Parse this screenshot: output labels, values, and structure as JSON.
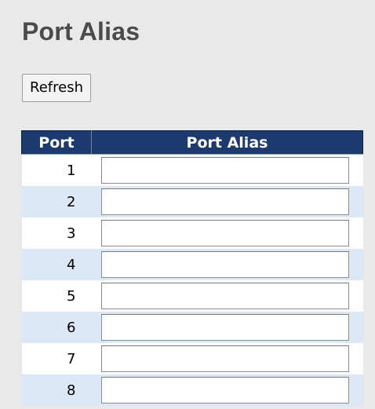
{
  "page": {
    "title": "Port Alias",
    "refresh_label": "Refresh"
  },
  "table": {
    "headers": {
      "port": "Port",
      "alias": "Port Alias"
    },
    "rows": [
      {
        "port": "1",
        "alias": ""
      },
      {
        "port": "2",
        "alias": ""
      },
      {
        "port": "3",
        "alias": ""
      },
      {
        "port": "4",
        "alias": ""
      },
      {
        "port": "5",
        "alias": ""
      },
      {
        "port": "6",
        "alias": ""
      },
      {
        "port": "7",
        "alias": ""
      },
      {
        "port": "8",
        "alias": ""
      }
    ]
  },
  "colors": {
    "header_bg": "#1c3a6e",
    "row_alt_bg": "#dde8f6",
    "page_bg": "#e9e9e9"
  }
}
